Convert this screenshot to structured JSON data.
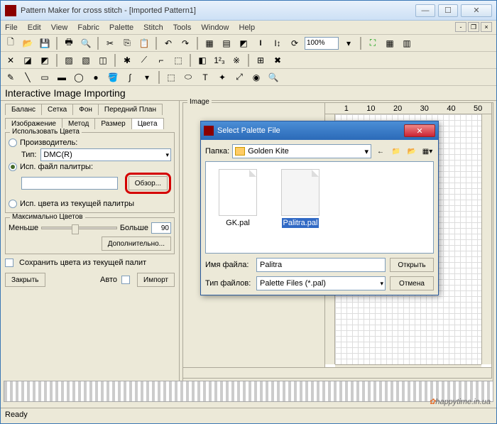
{
  "window": {
    "title": "Pattern Maker for cross stitch - [Imported Pattern1]"
  },
  "menus": [
    "File",
    "Edit",
    "View",
    "Fabric",
    "Palette",
    "Stitch",
    "Tools",
    "Window",
    "Help"
  ],
  "zoom": "100%",
  "panel_title": "Interactive Image Importing",
  "tabs_row1": [
    "Баланс",
    "Сетка",
    "Фон",
    "Передний План"
  ],
  "tabs_row2": [
    "Изображение",
    "Метод",
    "Размер",
    "Цвета"
  ],
  "colors_group": {
    "legend": "Использовать Цвета",
    "radio_manufacturer": "Производитель:",
    "type_label": "Тип:",
    "type_value": "DMC(R)",
    "radio_palette_file": "Исп. файл палитры:",
    "browse_btn": "Обзор...",
    "radio_current": "Исп. цвета из текущей палитры"
  },
  "max_colors": {
    "legend": "Максимально Цветов",
    "less": "Меньше",
    "more": "Больше",
    "value": "90",
    "additional": "Дополнительно..."
  },
  "save_colors": "Сохранить цвета из текущей палит",
  "buttons": {
    "close": "Закрыть",
    "auto": "Авто",
    "import": "Импорт"
  },
  "image_label": "Image",
  "ruler_marks": [
    "1",
    "10",
    "20",
    "30",
    "40",
    "50"
  ],
  "dialog": {
    "title": "Select Palette File",
    "folder_label": "Папка:",
    "folder_value": "Golden Kite",
    "files": [
      {
        "name": "GK.pal",
        "selected": false
      },
      {
        "name": "Palitra.pal",
        "selected": true
      }
    ],
    "filename_label": "Имя файла:",
    "filename_value": "Palitra",
    "filetype_label": "Тип файлов:",
    "filetype_value": "Palette Files (*.pal)",
    "open_btn": "Открыть",
    "cancel_btn": "Отмена"
  },
  "status": "Ready",
  "watermark": "happytime.in.ua"
}
